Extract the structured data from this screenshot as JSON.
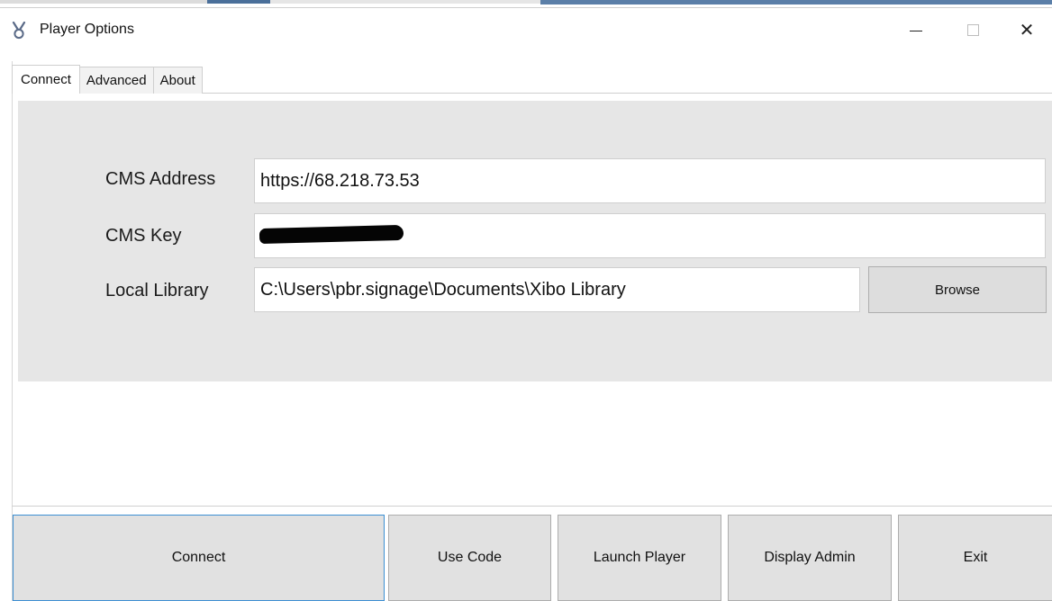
{
  "window": {
    "title": "Player Options",
    "minimize_glyph": "—",
    "close_glyph": "✕",
    "icon": "xibo-app-icon"
  },
  "tabs": [
    {
      "label": "Connect",
      "active": true
    },
    {
      "label": "Advanced",
      "active": false
    },
    {
      "label": "About",
      "active": false
    }
  ],
  "connect": {
    "cms_address": {
      "label": "CMS Address",
      "value": "https://68.218.73.53"
    },
    "cms_key": {
      "label": "CMS Key",
      "value": "",
      "redacted": true
    },
    "local_library": {
      "label": "Local Library",
      "value": "C:\\Users\\pbr.signage\\Documents\\Xibo Library"
    },
    "browse_label": "Browse"
  },
  "actions": {
    "connect": "Connect",
    "use_code": "Use Code",
    "launch_player": "Launch Player",
    "display_admin": "Display Admin",
    "exit": "Exit"
  },
  "colors": {
    "panel_bg": "#e6e6e6",
    "button_bg": "#e1e1e1",
    "focus_border": "#3c8fd3"
  }
}
